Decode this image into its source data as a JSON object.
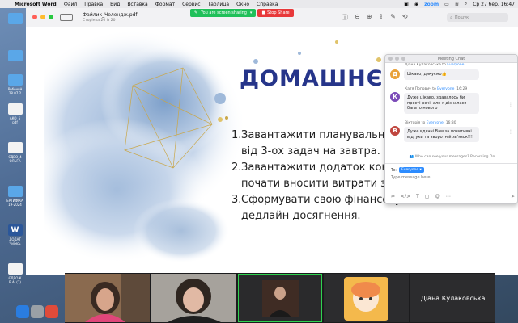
{
  "menubar": {
    "app_name": "Microsoft Word",
    "menu_items": [
      "Файл",
      "Правка",
      "Вид",
      "Вставка",
      "Формат",
      "Сервис",
      "Таблица",
      "Окно",
      "Справка"
    ],
    "zoom_label": "zoom",
    "datetime": "Ср 27 бер.  16:47"
  },
  "desktop": {
    "icons": [
      {
        "label": "",
        "kind": "folder"
      },
      {
        "label": "",
        "kind": "folder"
      },
      {
        "label": "Робочий\n28.07.2",
        "kind": "folder"
      },
      {
        "label": "АКО_5\npdf",
        "kind": "doc"
      },
      {
        "label": "ЄДБО_4\nОЛЬГА",
        "kind": "doc"
      },
      {
        "label": "ЕРТИФІКА\n19-2024",
        "kind": "folder"
      },
      {
        "label": "ДОДАТ\nЧиїмсь",
        "kind": "word"
      },
      {
        "label": "ЄДБО.К\nВ.А. (1)",
        "kind": "doc"
      }
    ]
  },
  "viewer": {
    "doc_title": "Файлик_Челендж.pdf",
    "page_info": "Сторінка 20 із 20",
    "search_placeholder": "Пошук"
  },
  "share_banner": {
    "status": "You are screen sharing",
    "stop_label": "Stop Share"
  },
  "slide": {
    "title": "ДОМАШНЄ ЗАВ",
    "items": [
      {
        "num": "1.",
        "line1": "Завантажити планувальник та",
        "line2": "від 3-ох задач на завтра."
      },
      {
        "num": "2.",
        "line1": "Завантажити додаток контрол",
        "line2": "почати вносити витрати за де"
      },
      {
        "num": "3.",
        "line1": "Сформувати свою фінансову ц",
        "line2": "дедлайн досягнення."
      }
    ]
  },
  "chat": {
    "title": "Meeting Chat",
    "messages": [
      {
        "initial": "Д",
        "color": "#e9a23b",
        "sender": "Діана Кулаковська",
        "to": "Everyone",
        "time": "",
        "text": "Цікаво, дякуємо👍"
      },
      {
        "initial": "К",
        "color": "#7b4bb8",
        "sender": "Катя Попович",
        "to": "Everyone",
        "time": "16:29",
        "text": "Дуже цікаво, здавалось би прості речі, але я дізналася багато нового"
      },
      {
        "initial": "В",
        "color": "#c0463f",
        "sender": "Вікторія",
        "to": "Everyone",
        "time": "16:30",
        "text": "Дуже вдячні Вам за позитивні відгуки та зворотній зв'язок!!!"
      }
    ],
    "privacy_text": "Who can see your messages? Recording On",
    "to_label": "To:",
    "recipient": "Everyone",
    "input_placeholder": "Type message here..."
  },
  "participants": [
    {
      "name": "",
      "bg": "#7a6048"
    },
    {
      "name": "",
      "bg": "#8d8a86"
    },
    {
      "name": "",
      "bg": "#2a2a2c"
    },
    {
      "name": "",
      "bg": "#f2b24a"
    },
    {
      "name": "Діана Кулаковська",
      "bg": "#2c2c2e"
    }
  ],
  "colors": {
    "slide_title": "#26358a",
    "share_green": "#20c05a",
    "stop_red": "#e8393a",
    "zoom_blue": "#2d8cff"
  }
}
